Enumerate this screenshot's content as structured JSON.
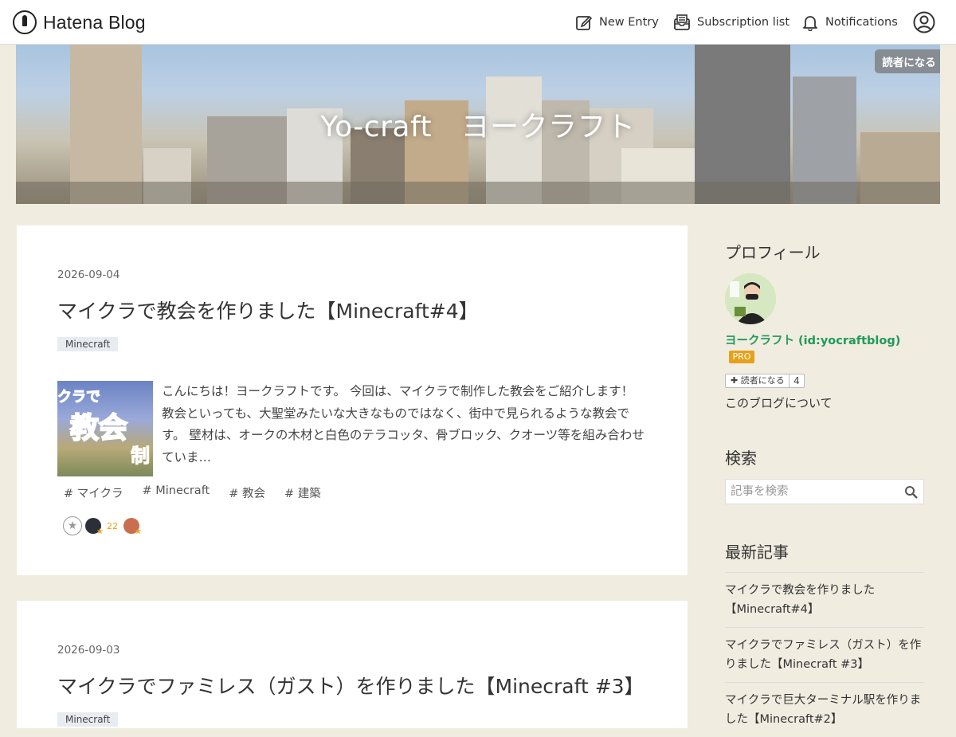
{
  "nav": {
    "logo_text": "Hatena Blog",
    "new_entry": "New Entry",
    "subscription_list": "Subscription list",
    "notifications": "Notifications"
  },
  "banner": {
    "title": "Yo-craft　ヨークラフト",
    "subscribe_label": "読者になる"
  },
  "posts": [
    {
      "date": "2026-09-04",
      "title": "マイクラで教会を作りました【Minecraft#4】",
      "category": "Minecraft",
      "thumb_top": "クラで",
      "thumb_big": "教会",
      "thumb_side": "制",
      "excerpt": "こんにちは！ヨークラフトです。 今回は、マイクラで制作した教会をご紹介します！ 教会といっても、大聖堂みたいな大きなものではなく、街中で見られるような教会です。 壁材は、オークの木材と白色のテラコッタ、骨ブロック、クオーツ等を組み合わせていま…",
      "hashtags": [
        "# マイクラ",
        "# Minecraft",
        "# 教会",
        "# 建築"
      ],
      "star_count": "22"
    },
    {
      "date": "2026-09-03",
      "title": "マイクラでファミレス（ガスト）を作りました【Minecraft #3】",
      "category": "Minecraft"
    }
  ],
  "sidebar": {
    "profile_heading": "プロフィール",
    "profile_name": "ヨークラフト (id:yocraftblog)",
    "pro_badge": "PRO",
    "reader_button": "読者になる",
    "reader_count": "4",
    "about_link": "このブログについて",
    "search_heading": "検索",
    "search_placeholder": "記事を検索",
    "recent_heading": "最新記事",
    "recent": [
      "マイクラで教会を作りました【Minecraft#4】",
      "マイクラでファミレス（ガスト）を作りました【Minecraft #3】",
      "マイクラで巨大ターミナル駅を作りました【Minecraft#2】"
    ]
  },
  "colors": {
    "page_bg": "#f1ece0",
    "profile_link": "#1f9a5a",
    "pro_badge": "#e6a11a",
    "star": "#f0a000"
  }
}
